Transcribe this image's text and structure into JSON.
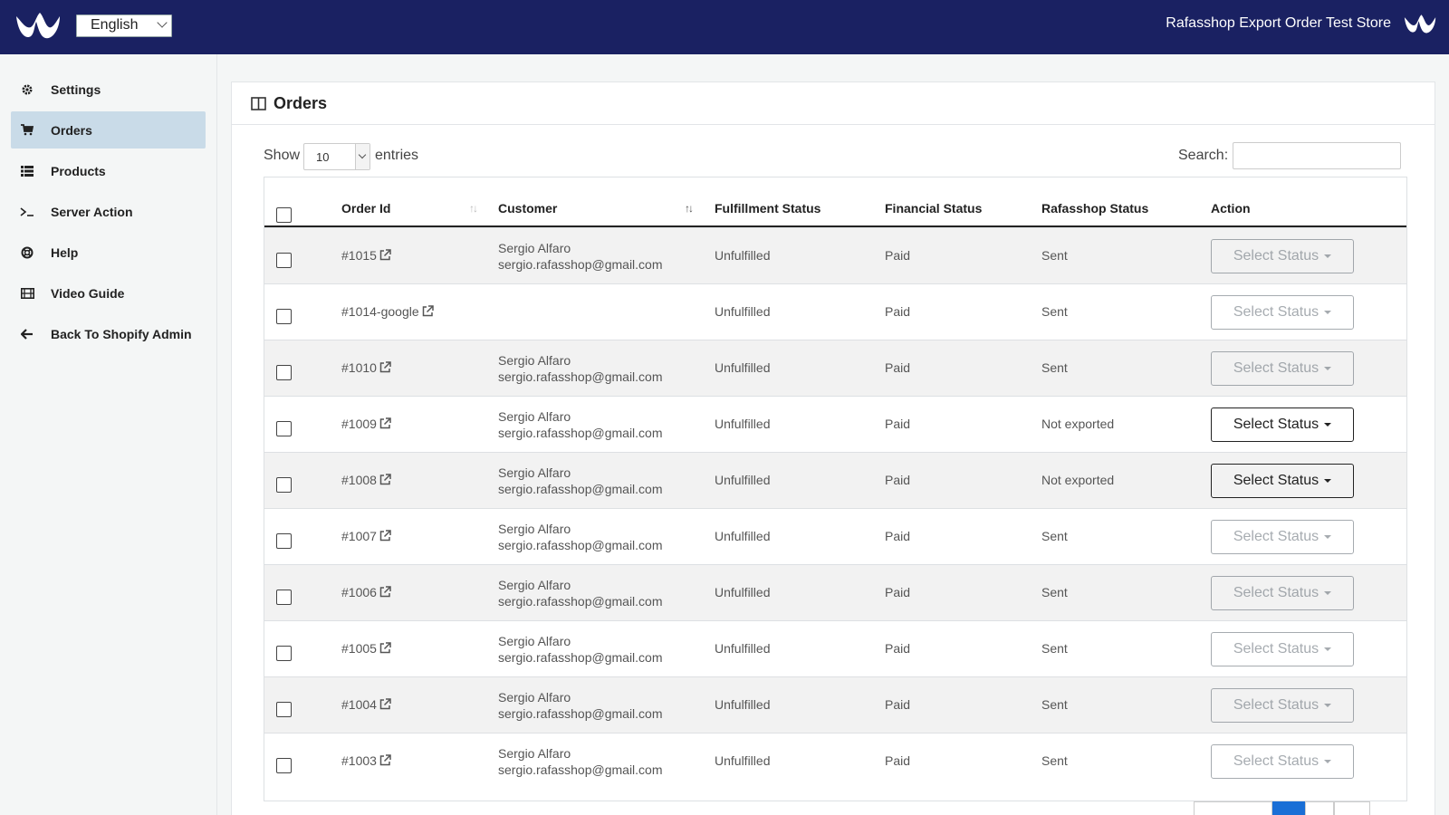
{
  "topbar": {
    "language": "English",
    "store_name": "Rafasshop Export Order Test Store"
  },
  "sidebar": {
    "items": [
      {
        "label": "Settings",
        "icon": "gear-icon"
      },
      {
        "label": "Orders",
        "icon": "cart-icon",
        "active": true
      },
      {
        "label": "Products",
        "icon": "list-icon"
      },
      {
        "label": "Server Action",
        "icon": "terminal-icon"
      },
      {
        "label": "Help",
        "icon": "lifebuoy-icon"
      },
      {
        "label": "Video Guide",
        "icon": "film-icon"
      },
      {
        "label": "Back To Shopify Admin",
        "icon": "arrow-left-icon"
      }
    ]
  },
  "card": {
    "title": "Orders"
  },
  "controls": {
    "show_label": "Show",
    "entries_value": "10",
    "entries_label": "entries",
    "search_label": "Search:",
    "search_value": ""
  },
  "table": {
    "headers": {
      "order_id": "Order Id",
      "customer": "Customer",
      "fulfillment": "Fulfillment Status",
      "financial": "Financial Status",
      "rafasshop": "Rafasshop Status",
      "action": "Action"
    },
    "action_label": "Select Status",
    "rows": [
      {
        "order_id": "#1015",
        "customer_name": "Sergio Alfaro",
        "customer_email": "sergio.rafasshop@gmail.com",
        "fulfillment": "Unfulfilled",
        "financial": "Paid",
        "rafasshop": "Sent",
        "action_enabled": false
      },
      {
        "order_id": "#1014-google",
        "customer_name": "",
        "customer_email": "",
        "fulfillment": "Unfulfilled",
        "financial": "Paid",
        "rafasshop": "Sent",
        "action_enabled": false
      },
      {
        "order_id": "#1010",
        "customer_name": "Sergio Alfaro",
        "customer_email": "sergio.rafasshop@gmail.com",
        "fulfillment": "Unfulfilled",
        "financial": "Paid",
        "rafasshop": "Sent",
        "action_enabled": false
      },
      {
        "order_id": "#1009",
        "customer_name": "Sergio Alfaro",
        "customer_email": "sergio.rafasshop@gmail.com",
        "fulfillment": "Unfulfilled",
        "financial": "Paid",
        "rafasshop": "Not exported",
        "action_enabled": true
      },
      {
        "order_id": "#1008",
        "customer_name": "Sergio Alfaro",
        "customer_email": "sergio.rafasshop@gmail.com",
        "fulfillment": "Unfulfilled",
        "financial": "Paid",
        "rafasshop": "Not exported",
        "action_enabled": true
      },
      {
        "order_id": "#1007",
        "customer_name": "Sergio Alfaro",
        "customer_email": "sergio.rafasshop@gmail.com",
        "fulfillment": "Unfulfilled",
        "financial": "Paid",
        "rafasshop": "Sent",
        "action_enabled": false
      },
      {
        "order_id": "#1006",
        "customer_name": "Sergio Alfaro",
        "customer_email": "sergio.rafasshop@gmail.com",
        "fulfillment": "Unfulfilled",
        "financial": "Paid",
        "rafasshop": "Sent",
        "action_enabled": false
      },
      {
        "order_id": "#1005",
        "customer_name": "Sergio Alfaro",
        "customer_email": "sergio.rafasshop@gmail.com",
        "fulfillment": "Unfulfilled",
        "financial": "Paid",
        "rafasshop": "Sent",
        "action_enabled": false
      },
      {
        "order_id": "#1004",
        "customer_name": "Sergio Alfaro",
        "customer_email": "sergio.rafasshop@gmail.com",
        "fulfillment": "Unfulfilled",
        "financial": "Paid",
        "rafasshop": "Sent",
        "action_enabled": false
      },
      {
        "order_id": "#1003",
        "customer_name": "Sergio Alfaro",
        "customer_email": "sergio.rafasshop@gmail.com",
        "fulfillment": "Unfulfilled",
        "financial": "Paid",
        "rafasshop": "Sent",
        "action_enabled": false
      }
    ]
  },
  "colors": {
    "topbar": "#1a2162",
    "active_nav": "#c9dbe8",
    "pager_active": "#1a6fd6"
  }
}
